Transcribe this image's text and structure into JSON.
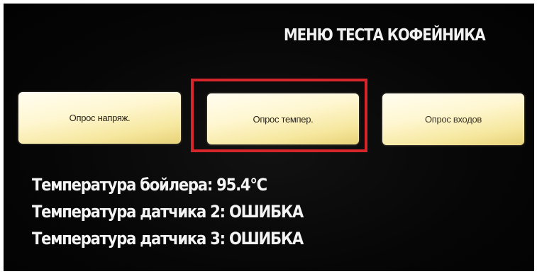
{
  "screen": {
    "title": "МЕНЮ ТЕСТА КОФЕЙНИКА"
  },
  "buttons": {
    "voltage": "Опрос напряж.",
    "temperature": "Опрос темпер.",
    "inputs": "Опрос входов"
  },
  "readings": [
    "Температура бойлера: 95.4°C",
    "Температура датчика 2: ОШИБКА",
    "Температура датчика 3: ОШИБКА"
  ],
  "colors": {
    "highlight_frame": "#d6262b",
    "button_fill": "#fff7d2",
    "screen_background": "#050505",
    "text": "#f4f4f4"
  }
}
